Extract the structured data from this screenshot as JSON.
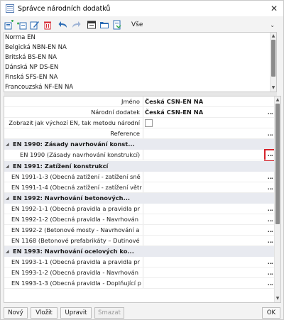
{
  "window": {
    "title": "Správce národních dodatků",
    "close_glyph": "✕"
  },
  "toolbar": {
    "icons": [
      "new-icon",
      "insert-icon",
      "edit-icon",
      "delete-icon",
      "undo-icon",
      "redo-icon",
      "table-icon",
      "save-icon",
      "export-icon"
    ],
    "filter_value": "Vše"
  },
  "top_list": {
    "items": [
      "Norma EN",
      "Belgická NBN-EN NA",
      "Britská BS-EN NA",
      "Dánská NP DS-EN",
      "Finská SFS-EN NA",
      "Francouzská NF-EN NA"
    ]
  },
  "properties": {
    "name_label": "Jméno",
    "name_value": "Česká CSN-EN NA",
    "annex_label": "Národní dodatek",
    "annex_value": "Česká CSN-EN NA",
    "show_label": "Zobrazit jak výchozí EN, tak metodu národní",
    "reference_label": "Reference",
    "dots": "..."
  },
  "sections": [
    {
      "title": "EN 1990: Zásady navrhování konst...",
      "items": [
        "EN 1990 (Zásady navrhování konstrukcí)"
      ]
    },
    {
      "title": "EN 1991: Zatížení konstrukcí",
      "items": [
        "EN 1991-1-3 (Obecná zatížení - zatížení sně",
        "EN 1991-1-4 (Obecná zatížení - zatížení větr"
      ]
    },
    {
      "title": "EN 1992: Navrhování betonových...",
      "items": [
        "EN 1992-1-1 (Obecná pravidla a pravidla pr",
        "EN 1992-1-2 (Obecná pravidla - Navrhován",
        "EN 1992-2 (Betonové mosty - Navrhování a",
        "EN 1168 (Betonové prefabrikáty – Dutinové"
      ]
    },
    {
      "title": "EN 1993: Navrhování ocelových ko...",
      "items": [
        "EN 1993-1-1 (Obecná pravidla a pravidla pr",
        "EN 1993-1-2 (Obecná pravidla - Navrhován",
        "EN 1993-1-3 (Obecná pravidla - Doplňující p"
      ]
    }
  ],
  "buttons": {
    "new": "Nový",
    "insert": "Vložit",
    "edit": "Upravit",
    "delete": "Smazat",
    "ok": "OK"
  },
  "colors": {
    "highlight_border": "#d6232b",
    "section_bg": "#e8eaf0"
  }
}
